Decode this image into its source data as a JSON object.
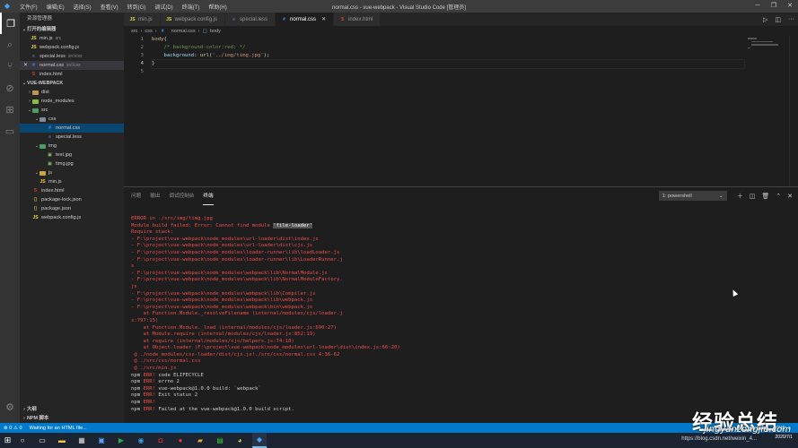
{
  "titlebar": {
    "menu": [
      "文件(F)",
      "编辑(E)",
      "选择(S)",
      "查看(V)",
      "转到(G)",
      "调试(D)",
      "终端(T)",
      "帮助(H)"
    ],
    "window_title": "normal.css - vue-webpack - Visual Studio Code [管理员]"
  },
  "sidebar": {
    "header": "资源管理器",
    "open_editors_title": "打开的编辑器",
    "open_editors": [
      {
        "name": "min.js",
        "hint": "src",
        "icon": "js"
      },
      {
        "name": "webpack.config.js",
        "hint": "",
        "icon": "js"
      },
      {
        "name": "special.less",
        "hint": "src\\css",
        "icon": "less"
      },
      {
        "name": "normal.css",
        "hint": "src\\css",
        "icon": "css"
      },
      {
        "name": "index.html",
        "hint": "",
        "icon": "html"
      }
    ],
    "project_title": "VUE-WEBPACK",
    "tree": [
      {
        "name": "dist",
        "icon": "folder"
      },
      {
        "name": "node_modules",
        "icon": "folder-node"
      },
      {
        "name": "src",
        "icon": "folder-src"
      },
      {
        "name": "css",
        "icon": "folder-gray"
      },
      {
        "name": "normal.css",
        "icon": "css"
      },
      {
        "name": "special.less",
        "icon": "less"
      },
      {
        "name": "img",
        "icon": "folder-src"
      },
      {
        "name": "test.jpg",
        "icon": "img"
      },
      {
        "name": "timg.jpg",
        "icon": "img"
      },
      {
        "name": "js",
        "icon": "folder-js"
      },
      {
        "name": "min.js",
        "icon": "js"
      },
      {
        "name": "index.html",
        "icon": "html"
      },
      {
        "name": "package-lock.json",
        "icon": "json"
      },
      {
        "name": "package.json",
        "icon": "json"
      },
      {
        "name": "webpack.config.js",
        "icon": "js"
      }
    ],
    "outline_title": "大纲",
    "npm_title": "NPM 脚本"
  },
  "tabs": [
    {
      "label": "min.js",
      "icon": "js"
    },
    {
      "label": "webpack.config.js",
      "icon": "js"
    },
    {
      "label": "special.less",
      "icon": "less"
    },
    {
      "label": "normal.css",
      "icon": "css"
    },
    {
      "label": "index.html",
      "icon": "html"
    }
  ],
  "breadcrumb": [
    "src",
    "css",
    "normal.css",
    "body"
  ],
  "editor": {
    "line_numbers": [
      "1",
      "2",
      "3",
      "4",
      "5"
    ],
    "lines": {
      "l1_selector": "body",
      "l1_brace": "{",
      "l2_comment": "/* background-color:red; */",
      "l3_prop": "background",
      "l3_colon": ": ",
      "l3_fn": "url",
      "l3_open": "(",
      "l3_str": "'../img/timg.jpg'",
      "l3_close": ");",
      "l4_brace": "}"
    }
  },
  "panel": {
    "tabs": [
      "问题",
      "输出",
      "调试控制台",
      "终端"
    ],
    "terminal_select": "1: powershell",
    "terminal_lines": [
      {
        "text": "ERROR in ./src/img/timg.jpg",
        "type": "err"
      },
      {
        "text": "Module build failed: Error: Cannot find module ",
        "highlight": "'file-loader'",
        "type": "err"
      },
      {
        "text": "Require stack:",
        "type": "err"
      },
      {
        "text": "- F:\\project\\vue-webpack\\node_modules\\url-loader\\dist\\index.js",
        "type": "err"
      },
      {
        "text": "- F:\\project\\vue-webpack\\node_modules\\url-loader\\dist\\cjs.js",
        "type": "err"
      },
      {
        "text": "- F:\\project\\vue-webpack\\node_modules\\loader-runner\\lib\\loadLoader.js",
        "type": "err"
      },
      {
        "text": "- F:\\project\\vue-webpack\\node_modules\\loader-runner\\lib\\LoaderRunner.j",
        "type": "err"
      },
      {
        "text": "s",
        "type": "err"
      },
      {
        "text": "- F:\\project\\vue-webpack\\node_modules\\webpack\\lib\\NormalModule.js",
        "type": "err"
      },
      {
        "text": "- F:\\project\\vue-webpack\\node_modules\\webpack\\lib\\NormalModuleFactory.",
        "type": "err"
      },
      {
        "text": "js",
        "type": "err"
      },
      {
        "text": "- F:\\project\\vue-webpack\\node_modules\\webpack\\lib\\Compiler.js",
        "type": "err"
      },
      {
        "text": "- F:\\project\\vue-webpack\\node_modules\\webpack\\lib\\webpack.js",
        "type": "err"
      },
      {
        "text": "- F:\\project\\vue-webpack\\node_modules\\webpack\\bin\\webpack.js",
        "type": "err"
      },
      {
        "text": "    at Function.Module._resolveFilename (internal/modules/cjs/loader.j",
        "type": "err"
      },
      {
        "text": "s:797:15)",
        "type": "err"
      },
      {
        "text": "    at Function.Module._load (internal/modules/cjs/loader.js:690:27)",
        "type": "err"
      },
      {
        "text": "    at Module.require (internal/modules/cjs/loader.js:852:19)",
        "type": "err"
      },
      {
        "text": "    at require (internal/modules/cjs/helpers.js:74:18)",
        "type": "err"
      },
      {
        "text": "    at Object.loader (F:\\project\\vue-webpack\\node_modules\\url-loader\\dist\\index.js:66:20)",
        "type": "err"
      },
      {
        "text": " @ ./node_modules/css-loader/dist/cjs.js!./src/css/normal.css 4:36-62",
        "type": "err"
      },
      {
        "text": " @ ./src/css/normal.css",
        "type": "err"
      },
      {
        "text": " @ ./src/min.js",
        "type": "err"
      },
      {
        "npm": "npm ",
        "tag": "ERR!",
        "rest": " code ELIFECYCLE",
        "type": "npm"
      },
      {
        "npm": "npm ",
        "tag": "ERR!",
        "rest": " errno 2",
        "type": "npm"
      },
      {
        "npm": "npm ",
        "tag": "ERR!",
        "rest": " vue-webpack@1.0.0 build: `webpack`",
        "type": "npm"
      },
      {
        "npm": "npm ",
        "tag": "ERR!",
        "rest": " Exit status 2",
        "type": "npm"
      },
      {
        "npm": "npm ",
        "tag": "ERR!",
        "rest": "",
        "type": "npm"
      },
      {
        "npm": "npm ",
        "tag": "ERR!",
        "rest": " Failed at the vue-webpack@1.0.0 build script.",
        "type": "npm"
      }
    ]
  },
  "statusbar": {
    "left": [
      "⊗ 0 ⚠ 0",
      "Waiting for an HTML file..."
    ],
    "right": [
      "行 4, 列 2",
      "空格: 4"
    ]
  },
  "taskbar": {
    "clock_date": "2020/7/1"
  },
  "watermark": {
    "big": "经验总结",
    "url": "jingyanzongjie.com",
    "blog": "https://blog.csdn.net/weixin_4..."
  },
  "colors": {
    "statusbar": "#007acc",
    "error_text": "#f14c4c",
    "editor_bg": "#1e1e1e",
    "sidebar_bg": "#252526"
  }
}
